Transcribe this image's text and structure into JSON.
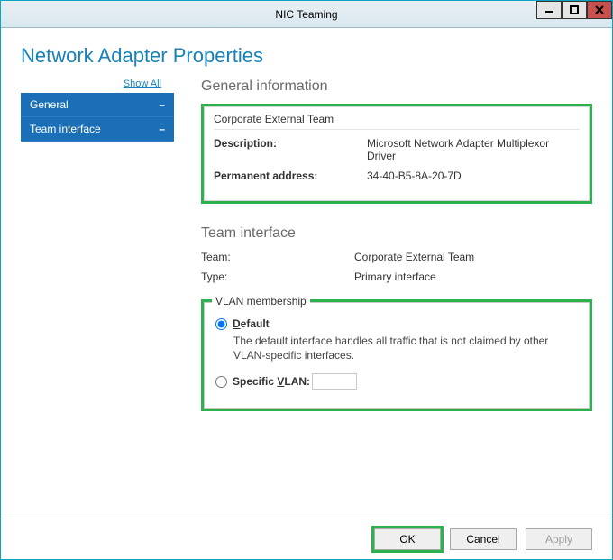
{
  "window": {
    "title": "NIC Teaming"
  },
  "page": {
    "heading": "Network Adapter Properties"
  },
  "sidebar": {
    "show_all": "Show All",
    "items": [
      {
        "label": "General"
      },
      {
        "label": "Team interface"
      }
    ]
  },
  "general": {
    "heading": "General information",
    "team_name": "Corporate External Team",
    "description_label": "Description:",
    "description_value": "Microsoft Network Adapter Multiplexor Driver",
    "perm_addr_label": "Permanent address:",
    "perm_addr_value": "34-40-B5-8A-20-7D"
  },
  "team_interface": {
    "heading": "Team interface",
    "team_label": "Team:",
    "team_value": "Corporate External Team",
    "type_label": "Type:",
    "type_value": "Primary interface"
  },
  "vlan": {
    "legend": "VLAN membership",
    "default_label_pre": "D",
    "default_label_rest": "efault",
    "default_desc": "The default interface handles all traffic that is not claimed by other VLAN-specific interfaces.",
    "specific_label_pre": "Specific ",
    "specific_label_ul": "V",
    "specific_label_rest": "LAN:",
    "specific_value": ""
  },
  "footer": {
    "ok": "OK",
    "cancel": "Cancel",
    "apply": "Apply"
  }
}
